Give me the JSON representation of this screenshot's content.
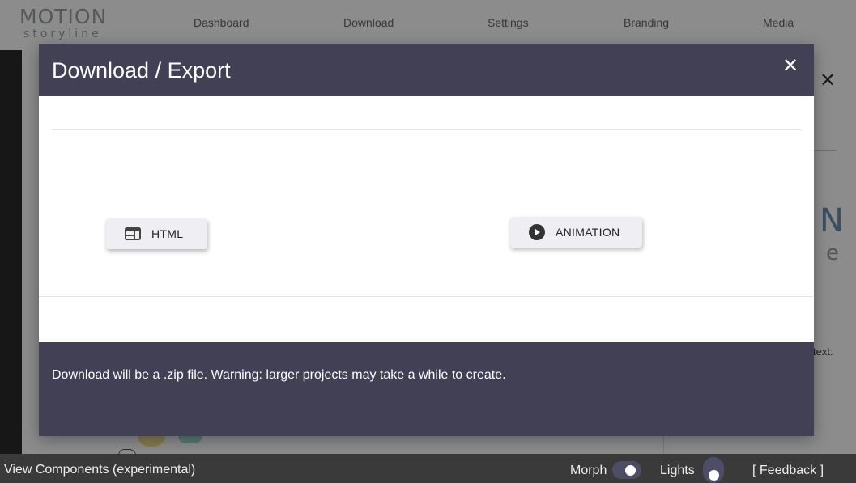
{
  "app": {
    "logo_top": "MOTION",
    "logo_bottom": "storyline"
  },
  "nav": {
    "items": [
      {
        "label": "Dashboard"
      },
      {
        "label": "Download"
      },
      {
        "label": "Settings"
      },
      {
        "label": "Branding"
      },
      {
        "label": "Media"
      }
    ]
  },
  "right_panel": {
    "close_glyph": "✕",
    "logo_fragment_top": "N",
    "logo_fragment_bottom": "e",
    "text_fragment": "text:"
  },
  "modal": {
    "title": "Download / Export",
    "close_glyph": "✕",
    "buttons": {
      "html": {
        "label": "HTML",
        "icon": "web-window-icon"
      },
      "animation": {
        "label": "ANIMATION",
        "icon": "play-circle-icon"
      }
    },
    "footer_text": "Download will be a .zip file. Warning: larger projects may take a while to create."
  },
  "bottom_bar": {
    "view_components": "View Components (experimental)",
    "morph_label": "Morph",
    "morph_on": true,
    "lights_label": "Lights",
    "feedback": "[ Feedback ]"
  },
  "colors": {
    "header_bg": "#424054",
    "button_bg": "#efeef3",
    "bottom_bar_bg": "#3a3a3a",
    "toggle_bg": "#4e4d66",
    "logo_accent": "#6b8fae"
  }
}
